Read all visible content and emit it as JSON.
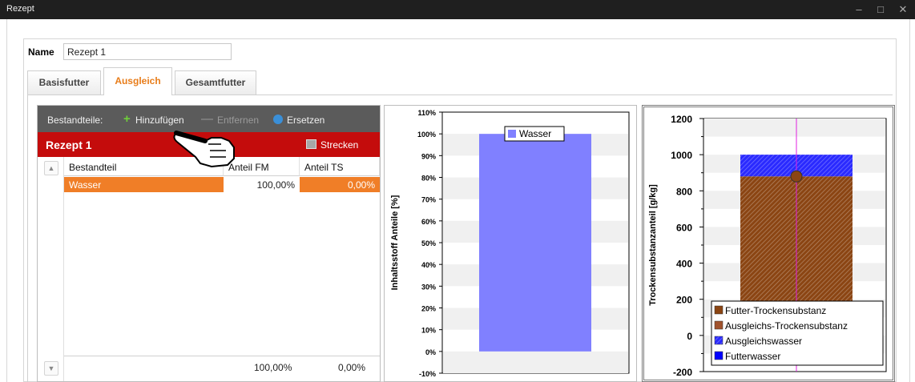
{
  "window": {
    "title": "Rezept",
    "minimize": "–",
    "maximize": "□",
    "close": "✕"
  },
  "name_field": {
    "label": "Name",
    "value": "Rezept 1"
  },
  "tabs": [
    {
      "label": "Basisfutter",
      "active": false
    },
    {
      "label": "Ausgleich",
      "active": true
    },
    {
      "label": "Gesamtfutter",
      "active": false
    }
  ],
  "toolbar": {
    "label": "Bestandteile:",
    "add_label": "Hinzufügen",
    "remove_label": "Entfernen",
    "replace_label": "Ersetzen"
  },
  "recipe_bar": {
    "title": "Rezept 1",
    "stretch_label": "Strecken"
  },
  "table": {
    "columns": [
      "Bestandteil",
      "Anteil FM",
      "Anteil TS"
    ],
    "rows": [
      {
        "name": "Wasser",
        "fm": "100,00%",
        "ts": "0,00%"
      }
    ],
    "totals": {
      "fm": "100,00%",
      "ts": "0,00%"
    }
  },
  "chart_data": [
    {
      "type": "bar",
      "ylabel": "Inhaltsstoff Anteile [%]",
      "yticks": [
        "-10%",
        "0%",
        "10%",
        "20%",
        "30%",
        "40%",
        "50%",
        "60%",
        "70%",
        "80%",
        "90%",
        "100%",
        "110%"
      ],
      "ylim": [
        -10,
        110
      ],
      "series": [
        {
          "name": "Wasser",
          "values": [
            100
          ],
          "color": "#8080ff"
        }
      ],
      "legend": "top-center"
    },
    {
      "type": "bar",
      "ylabel": "Trockensubstanzanteil [g/kg]",
      "yticks": [
        "-200",
        "0",
        "200",
        "400",
        "600",
        "800",
        "1000",
        "1200"
      ],
      "ylim": [
        -200,
        1200
      ],
      "stacked": true,
      "series": [
        {
          "name": "Futter-Trockensubstanz",
          "values": [
            0
          ],
          "color": "#8b4513"
        },
        {
          "name": "Ausgleichs-Trockensubstanz",
          "values": [
            880
          ],
          "color": "#a0522d"
        },
        {
          "name": "Ausgleichswasser",
          "values": [
            120
          ],
          "color": "#3a3aff"
        },
        {
          "name": "Futterwasser",
          "values": [
            0
          ],
          "color": "#0000ff"
        }
      ],
      "marker_value": 880,
      "legend": "bottom-right"
    }
  ]
}
